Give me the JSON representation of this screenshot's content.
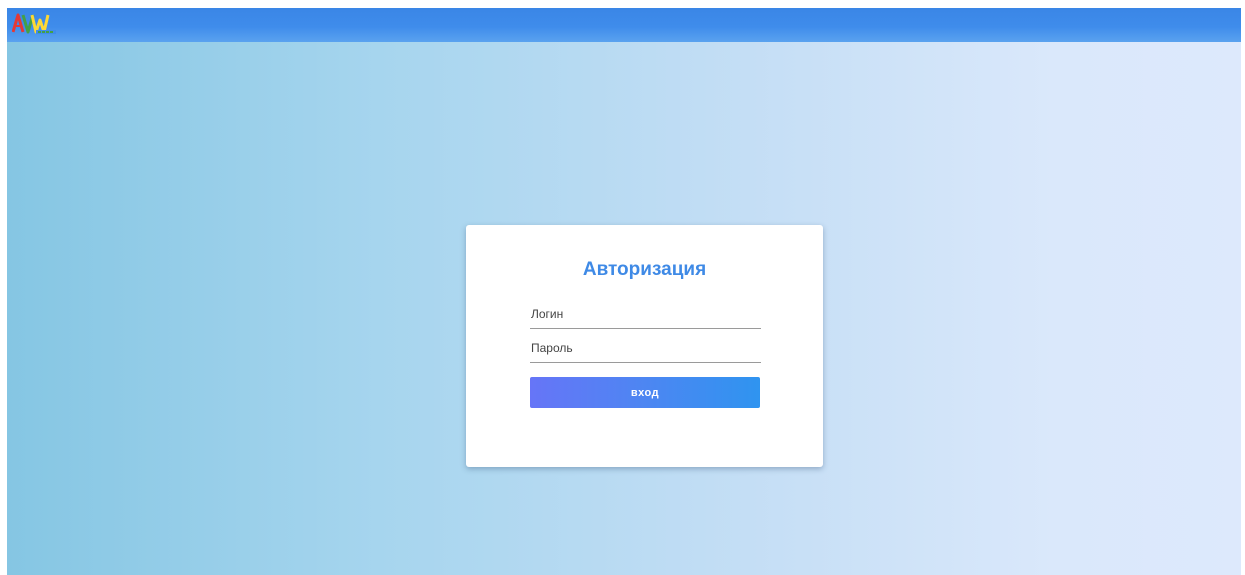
{
  "app": {
    "logo_alt": "AVV Soft logo"
  },
  "login_card": {
    "title": "Авторизация",
    "login_field": {
      "value": "",
      "placeholder": "Логин"
    },
    "password_field": {
      "value": "",
      "placeholder": "Пароль"
    },
    "submit_label": "вход"
  },
  "colors": {
    "topbar": "#3f8ceb",
    "title_accent": "#3f8ae6",
    "button_gradient_start": "#6675f7",
    "button_gradient_end": "#2f94f0",
    "background_start": "#85c6e3",
    "background_end": "#dde9fc"
  },
  "icons": {
    "logo": "avv-soft-logo"
  }
}
